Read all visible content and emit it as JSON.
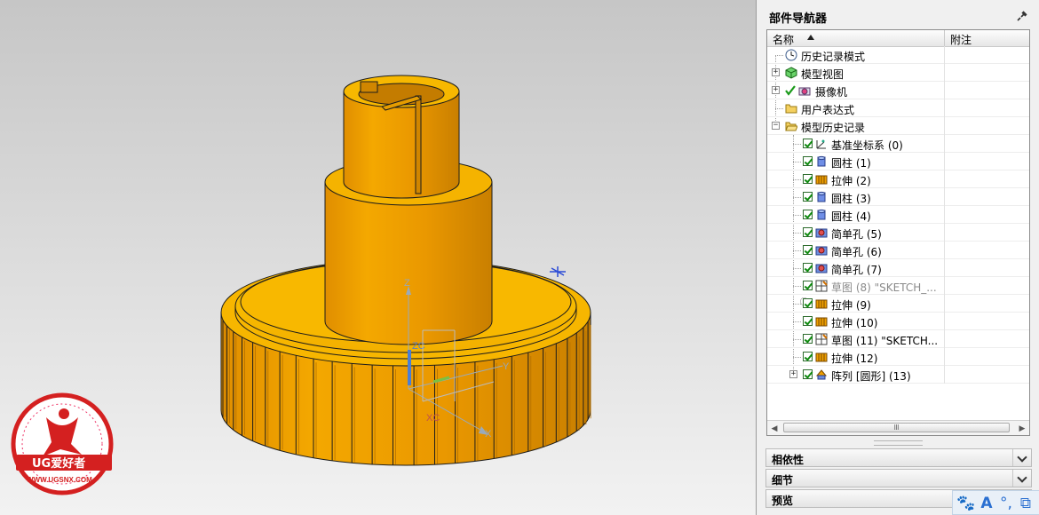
{
  "watermark": {
    "brand": "UG爱好者",
    "url": "WWW.UGSNX.COM"
  },
  "axes": {
    "z": "Z",
    "zc": "ZC",
    "y": "Y",
    "x": "X",
    "xc": "XC"
  },
  "navigator": {
    "title": "部件导航器",
    "col_name": "名称",
    "col_note": "附注",
    "items": [
      {
        "label": "历史记录模式",
        "icon": "clock-icon"
      },
      {
        "label": "模型视图",
        "icon": "model-view-icon"
      },
      {
        "label": "摄像机",
        "icon": "camera-icon"
      },
      {
        "label": "用户表达式",
        "icon": "folder-icon"
      },
      {
        "label": "模型历史记录",
        "icon": "folder-open-icon"
      },
      {
        "label": "基准坐标系 (0)",
        "icon": "datum-csys-icon"
      },
      {
        "label": "圆柱 (1)",
        "icon": "cylinder-icon"
      },
      {
        "label": "拉伸 (2)",
        "icon": "extrude-icon"
      },
      {
        "label": "圆柱 (3)",
        "icon": "cylinder-icon"
      },
      {
        "label": "圆柱 (4)",
        "icon": "cylinder-icon"
      },
      {
        "label": "简单孔 (5)",
        "icon": "hole-icon"
      },
      {
        "label": "简单孔 (6)",
        "icon": "hole-icon"
      },
      {
        "label": "简单孔 (7)",
        "icon": "hole-icon"
      },
      {
        "label": "草图 (8) \"SKETCH_...",
        "icon": "sketch-icon"
      },
      {
        "label": "拉伸 (9)",
        "icon": "extrude-icon"
      },
      {
        "label": "拉伸 (10)",
        "icon": "extrude-icon"
      },
      {
        "label": "草图 (11) \"SKETCH...",
        "icon": "sketch-icon"
      },
      {
        "label": "拉伸 (12)",
        "icon": "extrude-icon"
      },
      {
        "label": "阵列 [圆形] (13)",
        "icon": "pattern-icon"
      }
    ],
    "sections": {
      "dependencies": "相依性",
      "details": "细节",
      "preview": "预览"
    }
  },
  "colors": {
    "part": "#f0a000",
    "part_dark": "#c57f00",
    "part_light": "#f9c200",
    "edge": "#1c1c1c"
  }
}
